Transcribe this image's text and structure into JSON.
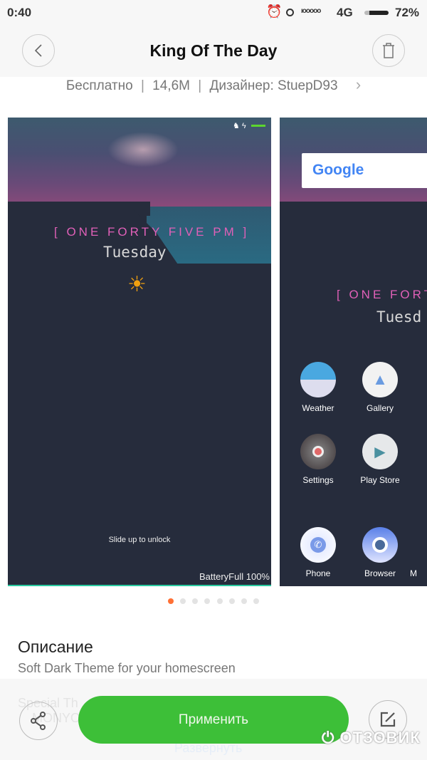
{
  "status_bar": {
    "time": "0:40",
    "network": "4G",
    "battery": "72%",
    "icons": [
      "alarm-icon",
      "circle-icon",
      "signal-icon",
      "battery-icon"
    ]
  },
  "header": {
    "title": "King Of The Day",
    "back_icon": "chevron-left-icon",
    "delete_icon": "trash-icon"
  },
  "meta": {
    "price": "Бесплатно",
    "size": "14,6M",
    "designer": "Дизайнер: StuepD93",
    "separator": "|"
  },
  "preview_lock": {
    "time_text": "[ ONE FORTY FIVE PM ]",
    "day": "Tuesday",
    "hint": "Slide up to unlock",
    "battery": "BatteryFull 100%",
    "accent": "#e060b8"
  },
  "preview_home": {
    "search": "Google",
    "time_text": "[ ONE FORTY",
    "day": "Tuesd",
    "apps": [
      {
        "label": "Weather"
      },
      {
        "label": "Gallery"
      },
      {
        "label": "Settings"
      },
      {
        "label": "Play Store"
      },
      {
        "label": "Phone"
      },
      {
        "label": "Browser"
      },
      {
        "label": "M"
      }
    ]
  },
  "pager": {
    "count": 8,
    "active": 0,
    "active_color": "#ff7035"
  },
  "description": {
    "heading": "Описание",
    "text": "Soft Dark Theme for your homescreen",
    "faded_1": "Special Th",
    "faded_2": "MONYO",
    "expand": "Развернуть"
  },
  "actions": {
    "apply": "Применить",
    "apply_color": "#3dbf38",
    "share_icon": "share-icon",
    "edit_icon": "edit-icon"
  },
  "watermark": "ОТЗОВИК"
}
